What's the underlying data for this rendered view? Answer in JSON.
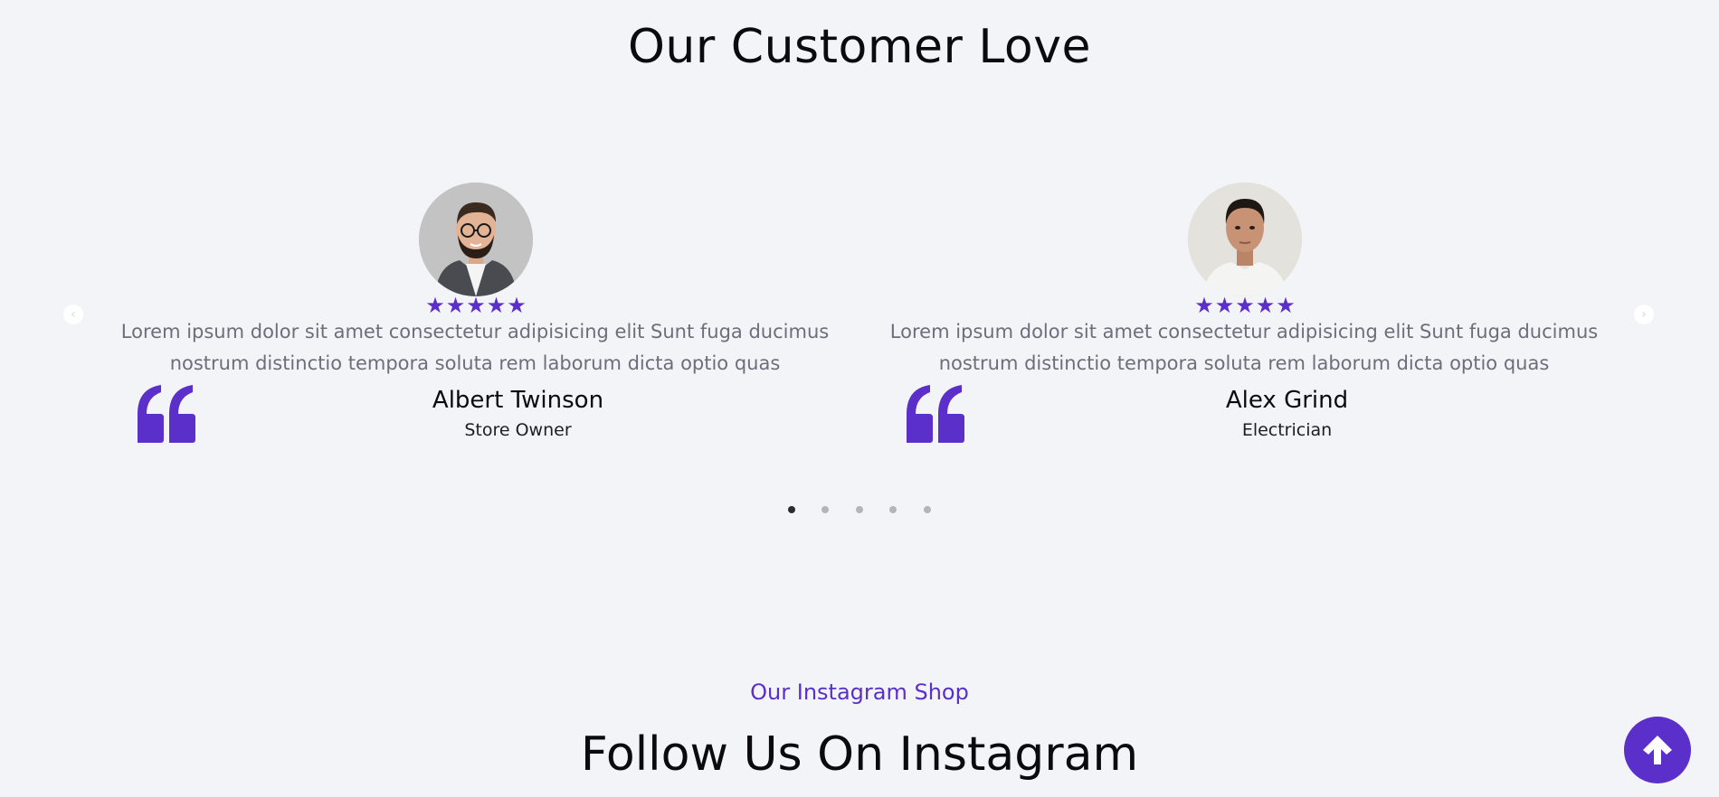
{
  "testimonials": {
    "title": "Our Customer Love",
    "items": [
      {
        "rating": 5,
        "text": "Lorem ipsum dolor sit amet consectetur adipisicing elit Sunt fuga ducimus nostrum distinctio tempora soluta rem laborum dicta optio quas",
        "name": "Albert Twinson",
        "role": "Store Owner"
      },
      {
        "rating": 5,
        "text": "Lorem ipsum dolor sit amet consectetur adipisicing elit Sunt fuga ducimus nostrum distinctio tempora soluta rem laborum dicta optio quas",
        "name": "Alex Grind",
        "role": "Electrician"
      }
    ],
    "pagination": {
      "total": 5,
      "active": 1
    }
  },
  "instagram": {
    "subtitle": "Our Instagram Shop",
    "title": "Follow Us On Instagram"
  },
  "icons": {
    "prev": "chevron-left-icon",
    "next": "chevron-right-icon",
    "quote": "quote-icon",
    "star": "star-icon",
    "scroll_top": "arrow-up-icon"
  },
  "colors": {
    "accent": "#5b2fc9",
    "background": "#f3f4f7",
    "text_muted": "#6b6f7b"
  }
}
